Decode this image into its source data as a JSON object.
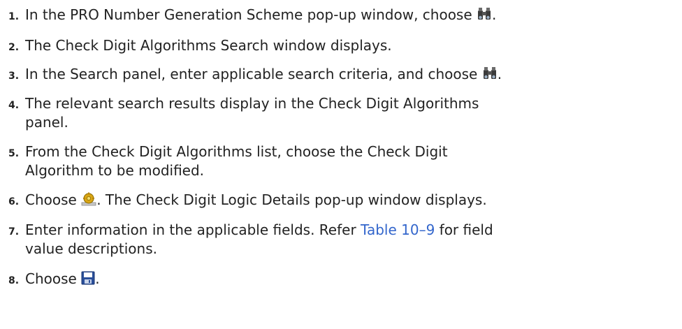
{
  "steps": [
    {
      "num": "1.",
      "before": "In the PRO Number Generation Scheme pop-up window, choose ",
      "icon": "binoculars-icon",
      "after": "."
    },
    {
      "num": "2.",
      "text": "The Check Digit Algorithms Search window displays."
    },
    {
      "num": "3.",
      "before": "In the Search panel, enter applicable search criteria, and choose ",
      "icon": "binoculars-icon",
      "after": "."
    },
    {
      "num": "4.",
      "line1": "The relevant search results display in the Check Digit Algorithms",
      "line2": "panel."
    },
    {
      "num": "5.",
      "line1": "From the Check Digit Algorithms list, choose the Check Digit",
      "line2": "Algorithm to be modified."
    },
    {
      "num": "6.",
      "before": "Choose ",
      "icon": "gear-details-icon",
      "after": ". The Check Digit Logic Details pop-up window displays."
    },
    {
      "num": "7.",
      "line1_before": "Enter information in the applicable fields. Refer ",
      "link": "Table 10–9",
      "line1_after": " for field",
      "line2": "value descriptions."
    },
    {
      "num": "8.",
      "before": "Choose ",
      "icon": "save-icon",
      "after": "."
    }
  ],
  "colors": {
    "text": "#222222",
    "link": "#3366cc"
  }
}
